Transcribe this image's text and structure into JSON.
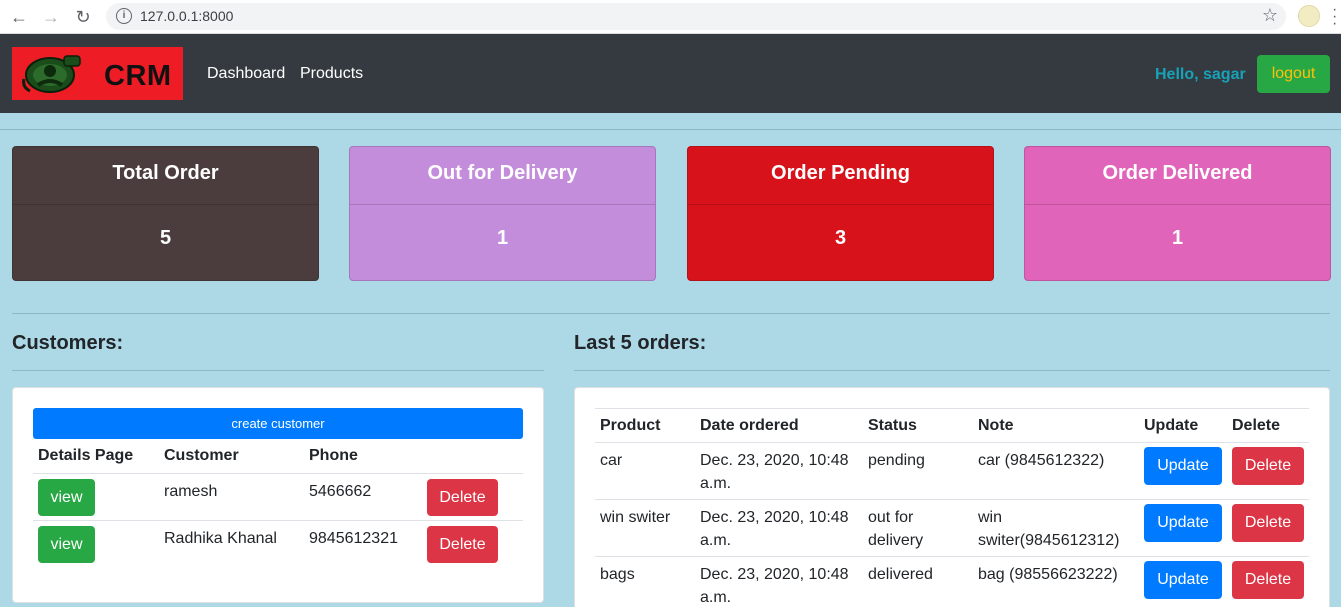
{
  "browser": {
    "url": "127.0.0.1:8000",
    "back_icon": "←",
    "forward_icon": "→",
    "reload_icon": "↻",
    "info_icon": "i",
    "star_icon": "☆"
  },
  "navbar": {
    "logo_text": "CRM",
    "links": [
      "Dashboard",
      "Products"
    ],
    "greeting": "Hello, sagar",
    "logout_label": "logout"
  },
  "stats": [
    {
      "title": "Total Order",
      "value": "5",
      "color": "#4b3d3d"
    },
    {
      "title": "Out for Delivery",
      "value": "1",
      "color": "#c48ddc"
    },
    {
      "title": "Order Pending",
      "value": "3",
      "color": "#d7121a"
    },
    {
      "title": "Order Delivered",
      "value": "1",
      "color": "#e064b9"
    }
  ],
  "customers": {
    "title": "Customers:",
    "create_label": "create customer",
    "headers": [
      "Details Page",
      "Customer",
      "Phone"
    ],
    "view_label": "view",
    "delete_label": "Delete",
    "rows": [
      {
        "name": "ramesh",
        "phone": "5466662"
      },
      {
        "name": "Radhika Khanal",
        "phone": "9845612321"
      }
    ]
  },
  "orders": {
    "title": "Last 5 orders:",
    "headers": [
      "Product",
      "Date ordered",
      "Status",
      "Note",
      "Update",
      "Delete"
    ],
    "update_label": "Update",
    "delete_label": "Delete",
    "rows": [
      {
        "product": "car",
        "date": "Dec. 23, 2020, 10:48 a.m.",
        "status": "pending",
        "note": "car (9845612322)"
      },
      {
        "product": "win switer",
        "date": "Dec. 23, 2020, 10:48 a.m.",
        "status": "out for delivery",
        "note": "win switer(9845612312)"
      },
      {
        "product": "bags",
        "date": "Dec. 23, 2020, 10:48 a.m.",
        "status": "delivered",
        "note": "bag (98556623222)"
      }
    ]
  }
}
